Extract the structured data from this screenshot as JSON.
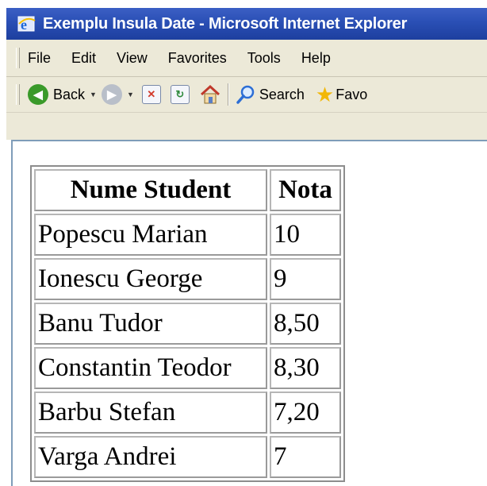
{
  "window": {
    "title": "Exemplu Insula Date - Microsoft Internet Explorer"
  },
  "menu": {
    "items": [
      {
        "label": "File"
      },
      {
        "label": "Edit"
      },
      {
        "label": "View"
      },
      {
        "label": "Favorites"
      },
      {
        "label": "Tools"
      },
      {
        "label": "Help"
      }
    ]
  },
  "toolbar": {
    "back_label": "Back",
    "search_label": "Search",
    "favorites_label": "Favo",
    "icons": [
      "back-arrow-icon",
      "forward-arrow-icon",
      "stop-icon",
      "refresh-icon",
      "home-icon",
      "search-icon",
      "favorites-star-icon"
    ]
  },
  "table": {
    "headers": [
      "Nume Student",
      "Nota"
    ],
    "rows": [
      {
        "name": "Popescu Marian",
        "grade": "10"
      },
      {
        "name": "Ionescu George",
        "grade": "9"
      },
      {
        "name": "Banu Tudor",
        "grade": "8,50"
      },
      {
        "name": "Constantin Teodor",
        "grade": "8,30"
      },
      {
        "name": "Barbu Stefan",
        "grade": "7,20"
      },
      {
        "name": "Varga Andrei",
        "grade": "7"
      }
    ]
  },
  "colors": {
    "titlebar": "#2a4fb5",
    "chrome": "#ece9d8",
    "back_icon": "#3a9a2a",
    "forward_icon": "#b9bfc9",
    "stop_icon": "#d23a2a",
    "refresh_icon": "#2f8a3c",
    "star_icon": "#f2b705"
  }
}
